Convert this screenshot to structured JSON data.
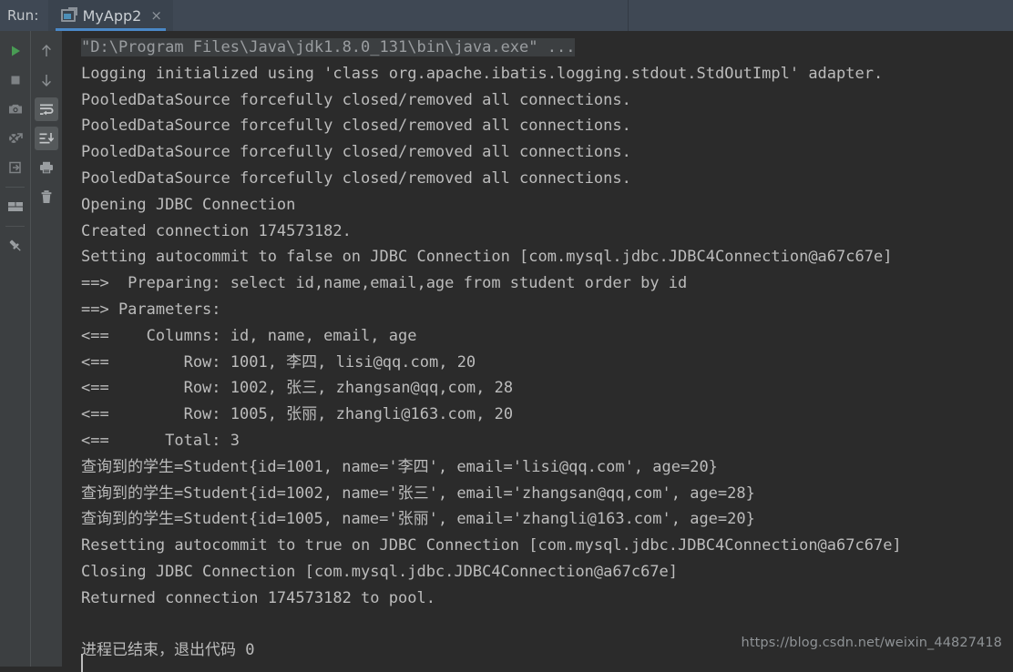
{
  "header": {
    "run_label": "Run:",
    "tab": {
      "title": "MyApp2",
      "close_label": "×",
      "icon": "run-configuration-icon",
      "underline_color": "#4a88c7"
    }
  },
  "toolbar_left": {
    "items": [
      {
        "name": "rerun-button",
        "icon": "play-icon",
        "active": false
      },
      {
        "name": "stop-button",
        "icon": "stop-square-icon",
        "active": false
      },
      {
        "name": "screenshot-button",
        "icon": "camera-icon",
        "active": false
      },
      {
        "name": "toggle-breakpoints-button",
        "icon": "breakpoint-mute-icon",
        "active": false
      },
      {
        "name": "export-button",
        "icon": "import-arrow-icon",
        "active": false
      },
      {
        "name": "layout-button",
        "icon": "panel-layout-icon",
        "active": false
      },
      {
        "name": "pin-tab-button",
        "icon": "pin-icon",
        "active": false
      }
    ]
  },
  "toolbar_right": {
    "items": [
      {
        "name": "up-the-stack-button",
        "icon": "arrow-up-icon",
        "active": false
      },
      {
        "name": "down-the-stack-button",
        "icon": "arrow-down-icon",
        "active": false
      },
      {
        "name": "soft-wrap-button",
        "icon": "soft-wrap-icon",
        "active": true
      },
      {
        "name": "scroll-to-end-button",
        "icon": "scroll-to-end-icon",
        "active": true
      },
      {
        "name": "print-button",
        "icon": "printer-icon",
        "active": false
      },
      {
        "name": "clear-all-button",
        "icon": "trash-icon",
        "active": false
      }
    ]
  },
  "console": {
    "command_line": "\"D:\\Program Files\\Java\\jdk1.8.0_131\\bin\\java.exe\" ...",
    "lines": [
      "Logging initialized using 'class org.apache.ibatis.logging.stdout.StdOutImpl' adapter.",
      "PooledDataSource forcefully closed/removed all connections.",
      "PooledDataSource forcefully closed/removed all connections.",
      "PooledDataSource forcefully closed/removed all connections.",
      "PooledDataSource forcefully closed/removed all connections.",
      "Opening JDBC Connection",
      "Created connection 174573182.",
      "Setting autocommit to false on JDBC Connection [com.mysql.jdbc.JDBC4Connection@a67c67e]",
      "==>  Preparing: select id,name,email,age from student order by id",
      "==> Parameters:",
      "<==    Columns: id, name, email, age",
      "<==        Row: 1001, 李四, lisi@qq.com, 20",
      "<==        Row: 1002, 张三, zhangsan@qq,com, 28",
      "<==        Row: 1005, 张丽, zhangli@163.com, 20",
      "<==      Total: 3",
      "查询到的学生=Student{id=1001, name='李四', email='lisi@qq.com', age=20}",
      "查询到的学生=Student{id=1002, name='张三', email='zhangsan@qq,com', age=28}",
      "查询到的学生=Student{id=1005, name='张丽', email='zhangli@163.com', age=20}",
      "Resetting autocommit to true on JDBC Connection [com.mysql.jdbc.JDBC4Connection@a67c67e]",
      "Closing JDBC Connection [com.mysql.jdbc.JDBC4Connection@a67c67e]",
      "Returned connection 174573182 to pool.",
      "",
      "进程已结束，退出代码 0"
    ]
  },
  "watermark": {
    "text": "https://blog.csdn.net/weixin_44827418"
  },
  "colors": {
    "header_bg": "#3f4854",
    "tab_bg": "#3a434e",
    "gutter_bg": "#3c3f41",
    "console_bg": "#2b2b2b",
    "console_text": "#bcbcbc",
    "command_text": "#9a9da0",
    "accent": "#4a88c7",
    "run_green": "#499c54"
  }
}
